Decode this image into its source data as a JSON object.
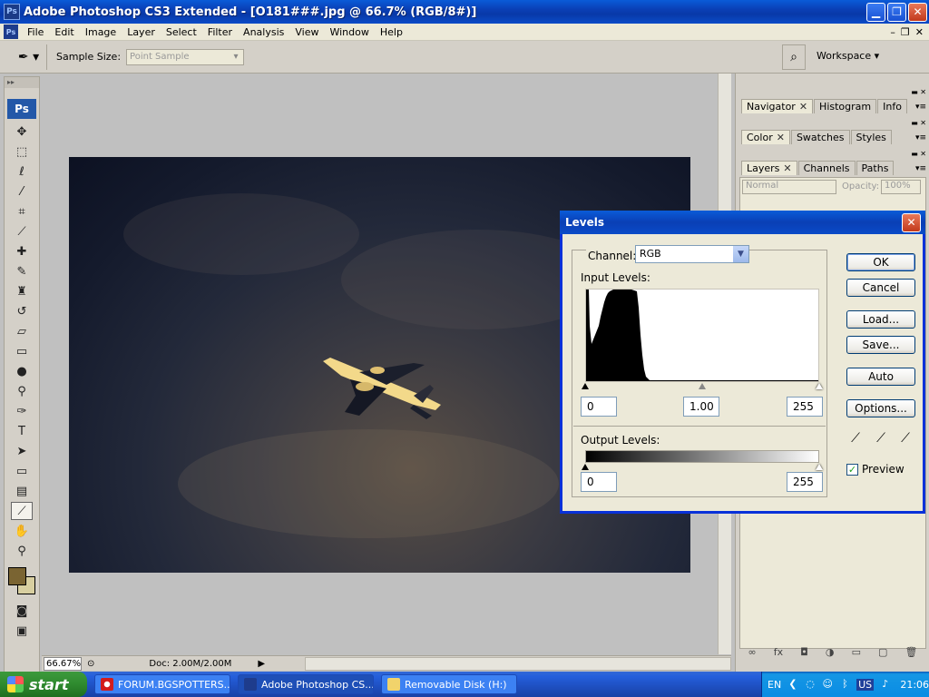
{
  "window": {
    "title": "Adobe Photoshop CS3 Extended - [O181###.jpg @ 66.7% (RGB/8#)]",
    "app_icon": "Ps",
    "controls": [
      "minimize-icon",
      "restore-icon",
      "close-icon"
    ]
  },
  "menubar": {
    "items": [
      "File",
      "Edit",
      "Image",
      "Layer",
      "Select",
      "Filter",
      "Analysis",
      "View",
      "Window",
      "Help"
    ]
  },
  "options": {
    "sample_size_label": "Sample Size:",
    "sample_size_value": "Point Sample",
    "workspace_label": "Workspace"
  },
  "toolbox": {
    "logo": "Ps",
    "tools": [
      "move-tool-icon",
      "marquee-tool-icon",
      "lasso-tool-icon",
      "magic-wand-icon",
      "crop-tool-icon",
      "eyedropper-slice-icon",
      "healing-brush-icon",
      "brush-tool-icon",
      "clone-stamp-icon",
      "history-brush-icon",
      "eraser-icon",
      "gradient-tool-icon",
      "blur-tool-icon",
      "dodge-tool-icon",
      "pen-tool-icon",
      "type-tool-icon",
      "path-selection-icon",
      "shape-tool-icon",
      "notes-tool-icon",
      "eyedropper-icon",
      "hand-tool-icon",
      "zoom-tool-icon"
    ],
    "foreground_color": "#7a6432",
    "background_color": "#d8cfa0"
  },
  "statusbar": {
    "zoom": "66.67%",
    "doc": "Doc: 2.00M/2.00M"
  },
  "panels": {
    "group1": [
      "Navigator",
      "Histogram",
      "Info"
    ],
    "group2": [
      "Color",
      "Swatches",
      "Styles"
    ],
    "group3": [
      "Layers",
      "Channels",
      "Paths"
    ],
    "blend_mode": "Normal",
    "opacity_label": "Opacity:",
    "opacity_value": "100%"
  },
  "levels": {
    "title": "Levels",
    "channel_label": "Channel:",
    "channel_value": "RGB",
    "input_label": "Input Levels:",
    "input_black": "0",
    "input_gamma": "1.00",
    "input_white": "255",
    "output_label": "Output Levels:",
    "output_black": "0",
    "output_white": "255",
    "buttons": {
      "ok": "OK",
      "cancel": "Cancel",
      "load": "Load...",
      "save": "Save...",
      "auto": "Auto",
      "options": "Options..."
    },
    "preview_label": "Preview",
    "preview_checked": true
  },
  "taskbar": {
    "start": "start",
    "tasks": [
      "FORUM.BGSPOTTERS...",
      "Adobe Photoshop CS...",
      "Removable Disk (H:)"
    ],
    "lang": "EN",
    "kbd": "US",
    "clock": "21:06"
  }
}
